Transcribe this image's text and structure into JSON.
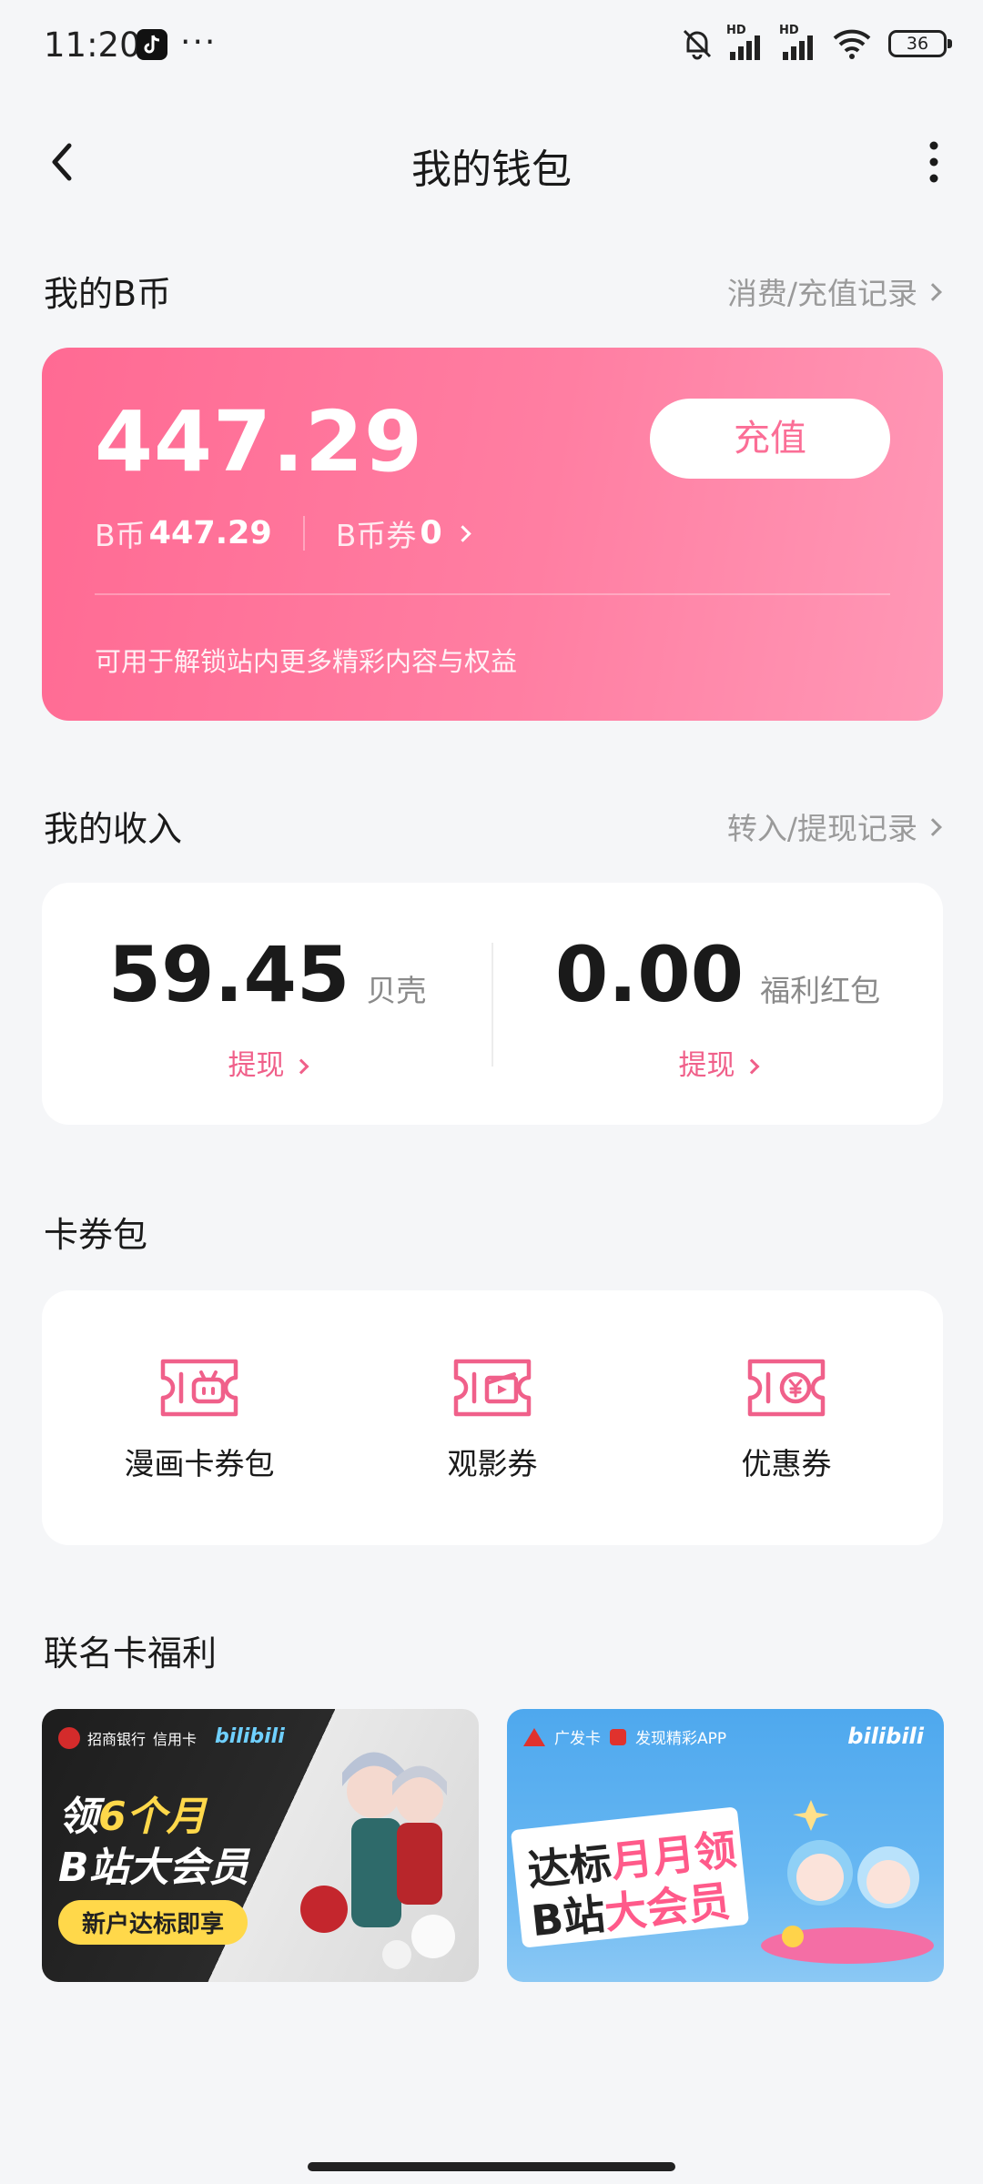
{
  "status_bar": {
    "time": "11:20",
    "dots": "···",
    "signal1_label": "HD",
    "signal2_label": "HD",
    "battery": "36",
    "icons": [
      "tiktok-icon",
      "mute-icon",
      "signal-icon",
      "signal-icon",
      "wifi-icon",
      "battery-icon"
    ]
  },
  "nav": {
    "title": "我的钱包",
    "back_icon": "chevron-left-icon",
    "more_icon": "more-vertical-icon"
  },
  "bcoin": {
    "section_title": "我的B币",
    "records_link": "消费/充值记录",
    "total": "447.29",
    "recharge_label": "充值",
    "bcoin_label": "B币",
    "bcoin_value": "447.29",
    "coupon_label": "B币券",
    "coupon_value": "0",
    "note": "可用于解锁站内更多精彩内容与权益",
    "gradient_start": "#ff6a93",
    "gradient_end": "#ff98b6"
  },
  "income": {
    "section_title": "我的收入",
    "records_link": "转入/提现记录",
    "shells_value": "59.45",
    "shells_unit": "贝壳",
    "shells_action": "提现",
    "redpacket_value": "0.00",
    "redpacket_unit": "福利红包",
    "redpacket_action": "提现",
    "accent": "#f0608a"
  },
  "vouchers": {
    "section_title": "卡券包",
    "items": [
      {
        "label": "漫画卡券包",
        "icon": "comic-ticket-icon"
      },
      {
        "label": "观影券",
        "icon": "movie-ticket-icon"
      },
      {
        "label": "优惠券",
        "icon": "yen-coupon-icon"
      }
    ]
  },
  "cobrand": {
    "section_title": "联名卡福利",
    "banners": [
      {
        "bank": "招商银行",
        "card": "信用卡",
        "brand": "bilibili",
        "line1_prefix": "领",
        "line1_highlight": "6个月",
        "line2": "B站大会员",
        "pill": "新户达标即享"
      },
      {
        "bank": "广发卡",
        "tagline": "发现精彩APP",
        "brand": "bilibili",
        "line1_a": "达标",
        "line1_b": "月月领",
        "line2_a": "B站",
        "line2_b": "大会员"
      }
    ]
  }
}
